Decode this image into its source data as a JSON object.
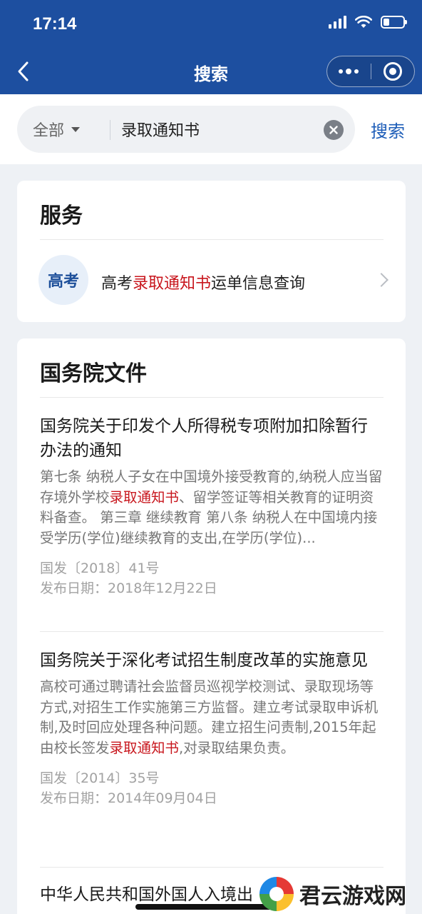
{
  "status_bar": {
    "time": "17:14"
  },
  "nav": {
    "title": "搜索"
  },
  "search": {
    "scope": "全部",
    "query": "录取通知书",
    "button": "搜索"
  },
  "services": {
    "title": "服务",
    "item": {
      "avatar": "高考",
      "prefix": "高考",
      "highlight": "录取通知书",
      "suffix": "运单信息查询"
    }
  },
  "docs": {
    "title": "国务院文件",
    "items": [
      {
        "title": "国务院关于印发个人所得税专项附加扣除暂行办法的通知",
        "snippet_before": "第七条 纳税人子女在中国境外接受教育的,纳税人应当留存境外学校",
        "snippet_highlight": "录取通知书",
        "snippet_after": "、留学签证等相关教育的证明资料备查。 第三章 继续教育 第八条 纳税人在中国境内接受学历(学位)继续教育的支出,在学历(学位)...",
        "doc_number": "国发〔2018〕41号",
        "date": "发布日期：2018年12月22日"
      },
      {
        "title": "国务院关于深化考试招生制度改革的实施意见",
        "snippet_before": "高校可通过聘请社会监督员巡视学校测试、录取现场等方式,对招生工作实施第三方监督。建立考试录取申诉机制,及时回应处理各种问题。建立招生问责制,2015年起由校长签发",
        "snippet_highlight": "录取通知书",
        "snippet_after": ",对录取结果负责。",
        "doc_number": "国发〔2014〕35号",
        "date": "发布日期：2014年09月04日"
      },
      {
        "title": "中华人民共和国外国人入境出"
      }
    ]
  },
  "watermark": {
    "text": "君云游戏网"
  },
  "colors": {
    "header_bg": "#1d4fa0",
    "accent": "#1d5db8",
    "highlight": "#c8161d",
    "page_bg": "#eef1f5"
  }
}
